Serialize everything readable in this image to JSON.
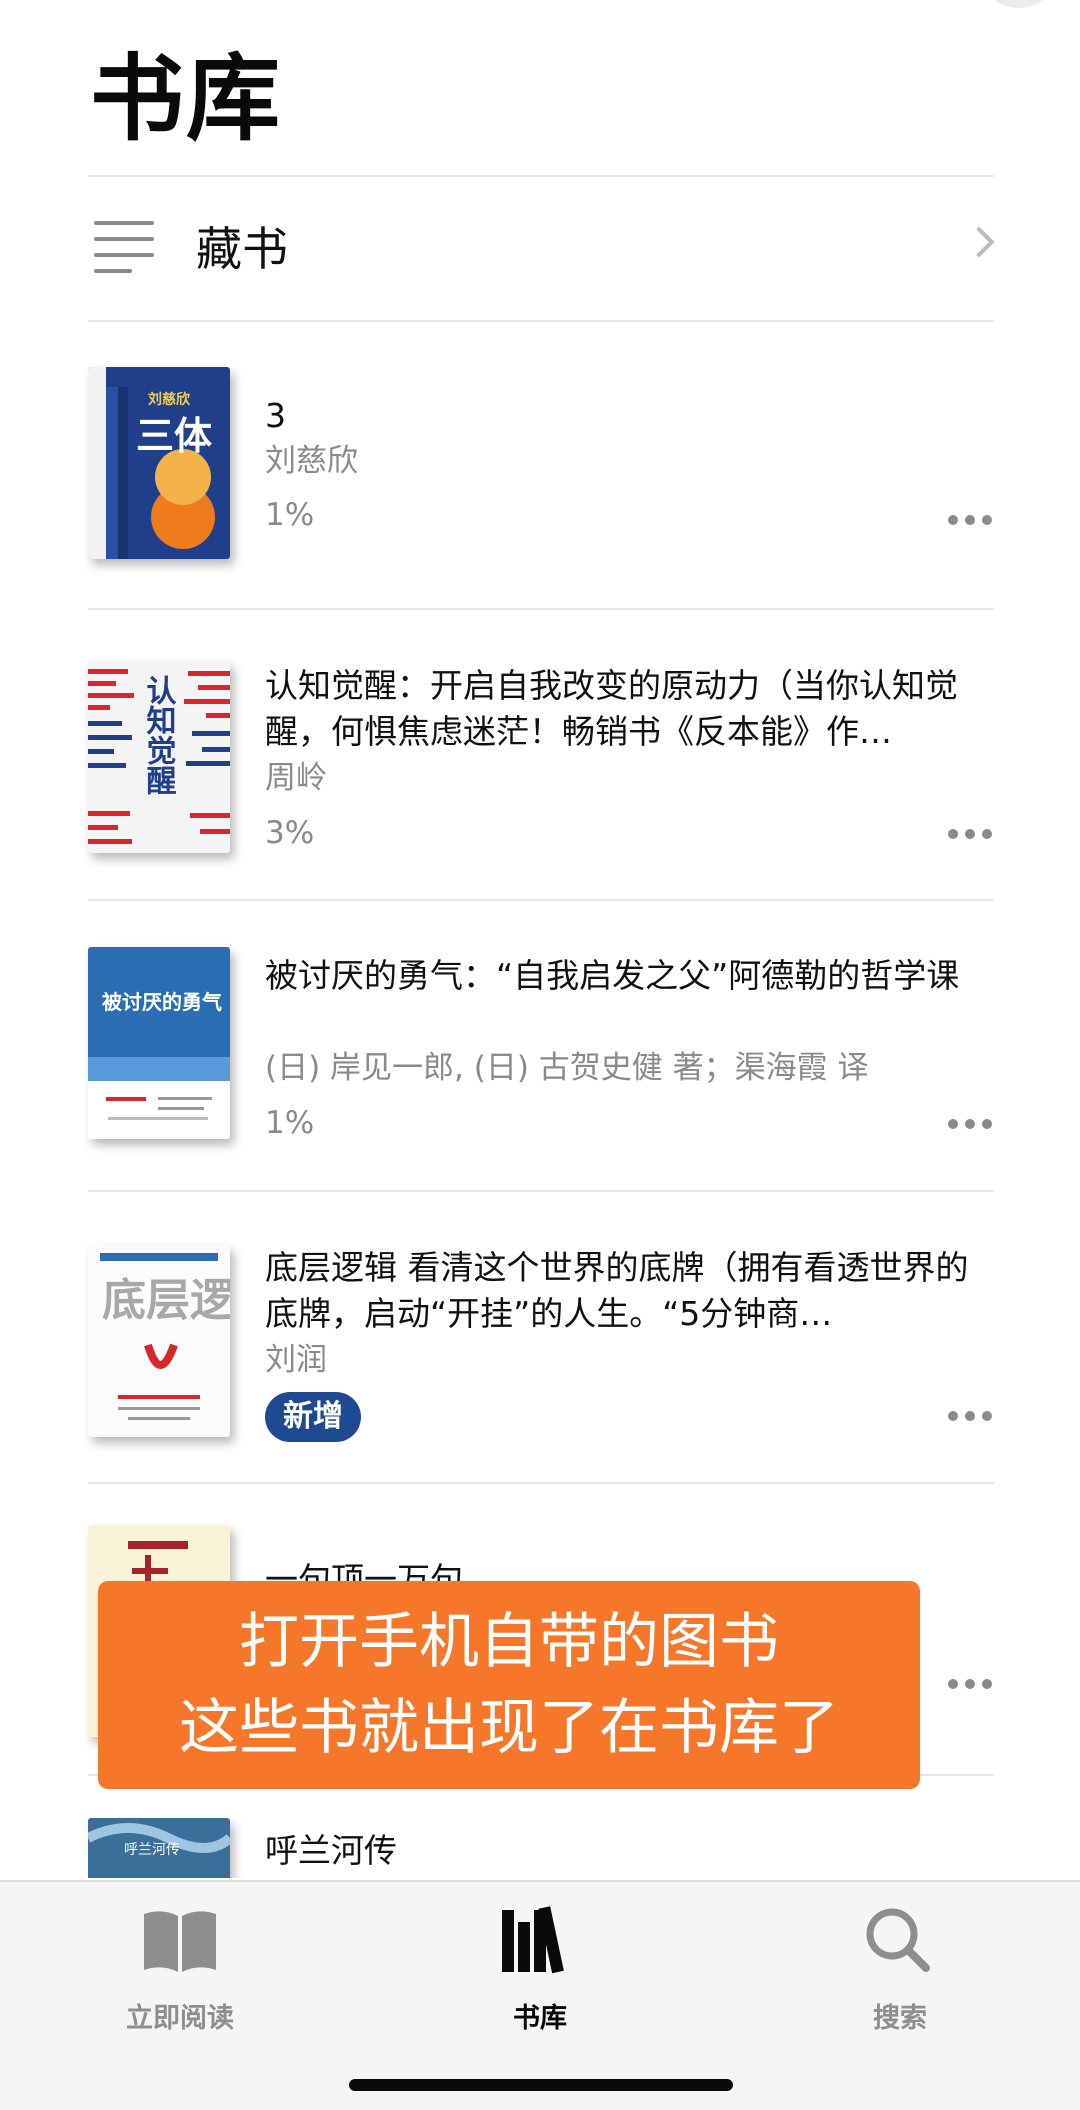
{
  "header": {
    "title": "书库"
  },
  "collections": {
    "label": "藏书"
  },
  "books": [
    {
      "title": "3",
      "author": "刘慈欣",
      "progress": "1%",
      "cover_text": "三体",
      "cover_author": "刘慈欣"
    },
    {
      "title": "认知觉醒：开启自我改变的原动力（当你认知觉醒，何惧焦虑迷茫！畅销书《反本能》作…",
      "author": "周岭",
      "progress": "3%",
      "cover_text": "认知觉醒"
    },
    {
      "title": "被讨厌的勇气：“自我启发之父”阿德勒的哲学课",
      "author": "(日) 岸见一郎, (日) 古贺史健 著；渠海霞 译",
      "progress": "1%",
      "cover_text": "被讨厌的勇气"
    },
    {
      "title": "底层逻辑 看清这个世界的底牌（拥有看透世界的底牌，启动“开挂”的人生。“5分钟商…",
      "author": "刘润",
      "badge": "新增",
      "cover_text": "底层逻辑"
    },
    {
      "title": "一句顶一万句"
    },
    {
      "title": "呼兰河传",
      "cover_text": "呼兰河传"
    }
  ],
  "overlay": {
    "line1": "打开手机自带的图书",
    "line2": "这些书就出现了在书库了"
  },
  "tabs": [
    {
      "label": "立即阅读",
      "icon": "book-open-icon",
      "selected": false
    },
    {
      "label": "书库",
      "icon": "library-icon",
      "selected": true
    },
    {
      "label": "搜索",
      "icon": "search-icon",
      "selected": false
    }
  ],
  "colors": {
    "accent_badge": "#1d4a91",
    "overlay_bg": "#f6772a",
    "secondary_text": "#8a8a8a",
    "tab_inactive": "#8e8e8e",
    "tab_active": "#0a0a0a"
  }
}
